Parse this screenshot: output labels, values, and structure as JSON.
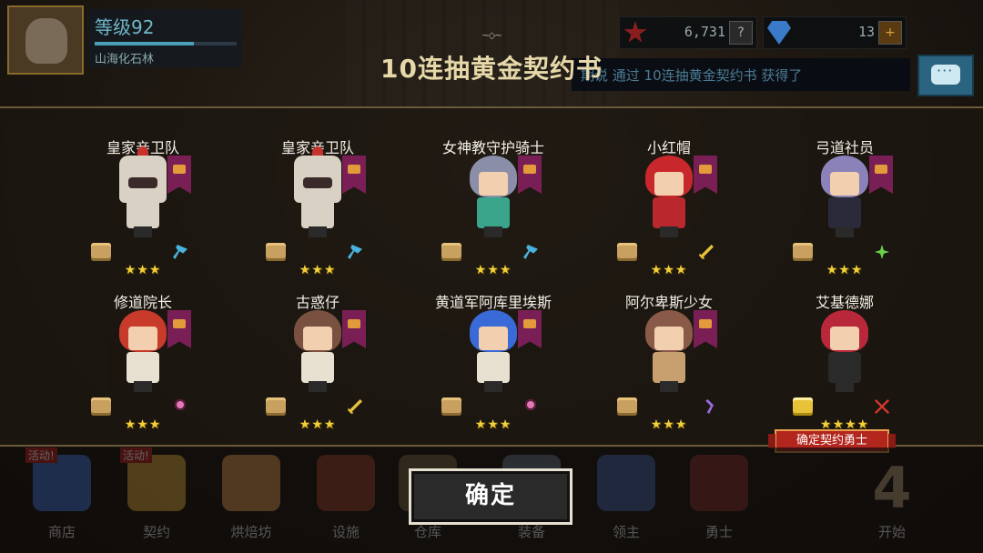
{
  "hud": {
    "level_label": "等级92",
    "area_name": "山海化石林",
    "resource_1_value": "6,731",
    "resource_1_button": "?",
    "resource_2_value": "13",
    "resource_2_button": "+",
    "notice_text": "期说 通过 10连抽黄金契约书 获得了"
  },
  "title": {
    "ornament": "~◇~",
    "text": "10连抽黄金契约书"
  },
  "results": [
    {
      "name": "皇家亲卫队",
      "stars": "★★★"
    },
    {
      "name": "皇家亲卫队",
      "stars": "★★★"
    },
    {
      "name": "女神教守护骑士",
      "stars": "★★★"
    },
    {
      "name": "小红帽",
      "stars": "★★★"
    },
    {
      "name": "弓道社员",
      "stars": "★★★"
    },
    {
      "name": "修道院长",
      "stars": "★★★"
    },
    {
      "name": "古惑仔",
      "stars": "★★★"
    },
    {
      "name": "黄道军阿库里埃斯",
      "stars": "★★★"
    },
    {
      "name": "阿尔卑斯少女",
      "stars": "★★★"
    },
    {
      "name": "艾基德娜",
      "stars": "★★★★"
    }
  ],
  "confirm_tag": "确定契约勇士",
  "ok_button": "确定",
  "nav": {
    "items": [
      {
        "label": "商店",
        "badge": "活动!"
      },
      {
        "label": "契约",
        "badge": "活动!"
      },
      {
        "label": "烘焙坊"
      },
      {
        "label": "设施"
      },
      {
        "label": "仓库"
      },
      {
        "label": "装备"
      },
      {
        "label": "领主"
      },
      {
        "label": "勇士"
      },
      {
        "label": "开始"
      }
    ],
    "start_number": "4"
  },
  "colors": {
    "title": "#e6d8a8",
    "stars": "#f3d03a",
    "confirm_tag": "#b2261e",
    "banner": "#7a1f56"
  }
}
